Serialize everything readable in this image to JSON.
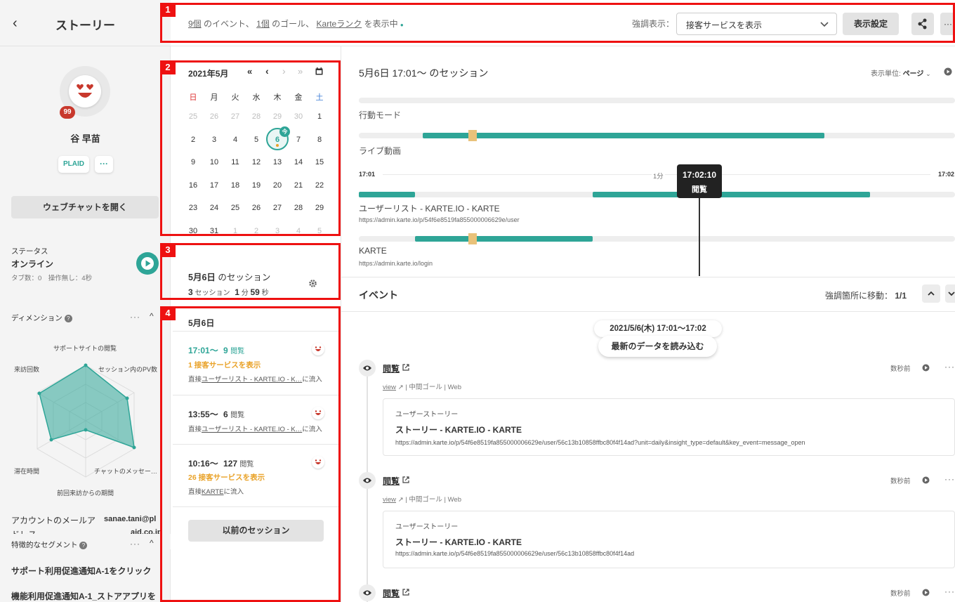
{
  "sidebar": {
    "back": "‹",
    "title": "ストーリー",
    "badge": "99",
    "user_name": "谷 早苗",
    "chip_label": "PLAID",
    "chip_more": "···",
    "webchat_button": "ウェブチャットを開く",
    "status_label": "ステータス",
    "status_value": "オンライン",
    "status_detail": "タブ数：0　操作無し：4秒",
    "dimension_label": "ディメンション",
    "radar_labels": [
      "サポートサイトの閲覧",
      "セッション内のPV数",
      "チャットのメッセー…",
      "前回来訪からの期間",
      "滞在時間",
      "来訪回数"
    ],
    "account_label": "アカウントのメールア",
    "account_label2": "ドレス",
    "account_value": "sanae.tani@pl",
    "account_value2": "aid.co.jp",
    "segment_label": "特徴的なセグメント",
    "segments": [
      "サポート利用促進通知A-1をクリック",
      "機能利用促進通知A-1_ストアアプリを"
    ]
  },
  "header": {
    "count_events": "9個",
    "text_events": "のイベント、",
    "count_goals": "1個",
    "text_goals": "のゴール、",
    "karte_rank": "Karteランク",
    "text_tail": "を表示中",
    "highlight_label": "強調表示：",
    "highlight_value": "接客サービスを表示",
    "display_settings": "表示設定",
    "more": "···"
  },
  "markers": [
    "1",
    "2",
    "3",
    "4"
  ],
  "calendar": {
    "month": "2021年5月",
    "nav": [
      "«",
      "‹",
      "›",
      "»"
    ],
    "weekdays": [
      "日",
      "月",
      "火",
      "水",
      "木",
      "金",
      "土"
    ],
    "today_badge": "今",
    "rows": [
      [
        "25",
        "26",
        "27",
        "28",
        "29",
        "30",
        "1"
      ],
      [
        "2",
        "3",
        "4",
        "5",
        "6",
        "7",
        "8"
      ],
      [
        "9",
        "10",
        "11",
        "12",
        "13",
        "14",
        "15"
      ],
      [
        "16",
        "17",
        "18",
        "19",
        "20",
        "21",
        "22"
      ],
      [
        "23",
        "24",
        "25",
        "26",
        "27",
        "28",
        "29"
      ],
      [
        "30",
        "31",
        "1",
        "2",
        "3",
        "4",
        "5"
      ]
    ]
  },
  "session_summary": {
    "date": "5月6日",
    "label": "のセッション",
    "count": "3",
    "count_unit": "セッション",
    "min": "1",
    "min_unit": "分",
    "sec": "59",
    "sec_unit": "秒"
  },
  "session_list": {
    "date": "5月6日",
    "items": [
      {
        "time": "17:01〜",
        "views": "9",
        "views_unit": "閲覧",
        "highlight": "1 接客サービスを表示",
        "source_prefix": "直接",
        "source_link": "ユーザーリスト - KARTE.IO - K…",
        "source_suffix": "に流入"
      },
      {
        "time": "13:55〜",
        "views": "6",
        "views_unit": "閲覧",
        "highlight": "",
        "source_prefix": "直接",
        "source_link": "ユーザーリスト - KARTE.IO - K…",
        "source_suffix": "に流入"
      },
      {
        "time": "10:16〜",
        "views": "127",
        "views_unit": "閲覧",
        "highlight": "26 接客サービスを表示",
        "source_prefix": "直接",
        "source_link": "KARTE",
        "source_suffix": "に流入"
      }
    ],
    "previous_button": "以前のセッション"
  },
  "timeline": {
    "title": "5月6日 17:01〜 のセッション",
    "unit_label": "表示単位:",
    "unit_value": "ページ",
    "mode_label": "行動モード",
    "live_label": "ライブ動画",
    "time_start": "17:01",
    "time_mid": "1分",
    "time_end": "17:02",
    "tooltip_time": "17:02:10",
    "tooltip_label": "閲覧",
    "page1_title": "ユーザーリスト - KARTE.IO - KARTE",
    "page1_url": "https://admin.karte.io/p/54f6e8519fa855000006629e/user",
    "page2_title": "KARTE",
    "page2_url": "https://admin.karte.io/login"
  },
  "events": {
    "title": "イベント",
    "jump_label": "強調箇所に移動：",
    "jump_value": "1/1",
    "range": "2021/5/6(木) 17:01〜17:02",
    "load_latest": "最新のデータを読み込む",
    "items": [
      {
        "name": "閲覧",
        "view": "view",
        "goal": "中間ゴール",
        "channel": "Web",
        "ago": "数秒前",
        "card_label": "ユーザーストーリー",
        "card_title": "ストーリー - KARTE.IO - KARTE",
        "card_url": "https://admin.karte.io/p/54f6e8519fa855000006629e/user/56c13b10858ffbc80f4f14ad?unit=daily&insight_type=default&key_event=message_open"
      },
      {
        "name": "閲覧",
        "view": "view",
        "goal": "中間ゴール",
        "channel": "Web",
        "ago": "数秒前",
        "card_label": "ユーザーストーリー",
        "card_title": "ストーリー - KARTE.IO - KARTE",
        "card_url": "https://admin.karte.io/p/54f6e8519fa855000006629e/user/56c13b10858ffbc80f4f14ad"
      },
      {
        "name": "閲覧",
        "ago": "数秒前"
      }
    ]
  },
  "colors": {
    "accent": "#2ea597",
    "highlight": "#e9a228",
    "marker": "#ee1111"
  }
}
